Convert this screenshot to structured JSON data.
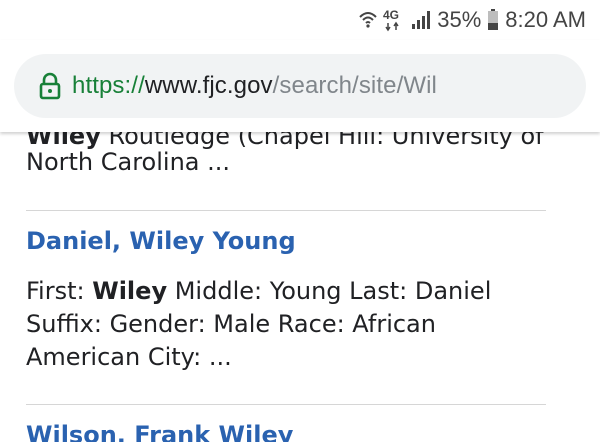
{
  "status_bar": {
    "network": "4G",
    "battery": "35%",
    "time": "8:20 AM",
    "icons": [
      "wifi-icon",
      "network-4g-icon",
      "signal-icon",
      "battery-icon"
    ]
  },
  "browser": {
    "url_scheme": "https://",
    "url_host": "www.fjc.gov",
    "url_path": "/search/site/Wil",
    "lock_icon": "lock-icon"
  },
  "results": {
    "partial_prev": {
      "cut_line_bold": "Wiley",
      "cut_line": " Routledge (Chapel Hill: University of",
      "snippet": "North Carolina ..."
    },
    "items": [
      {
        "title": "Daniel, Wiley Young",
        "snippet_lines": [
          {
            "a": "First:  ",
            "b": "Wiley",
            "c": " Middle:  Young Last:  Daniel"
          },
          {
            "a": "Suffix:  Gender:  Male Race:  African",
            "b": "",
            "c": ""
          },
          {
            "a": "American City:  ...",
            "b": "",
            "c": ""
          }
        ]
      },
      {
        "title": "Wilson, Frank Wiley"
      }
    ]
  },
  "colors": {
    "link": "#2a62b0",
    "secure_green": "#188038",
    "url_bar_bg": "#f1f3f4"
  }
}
